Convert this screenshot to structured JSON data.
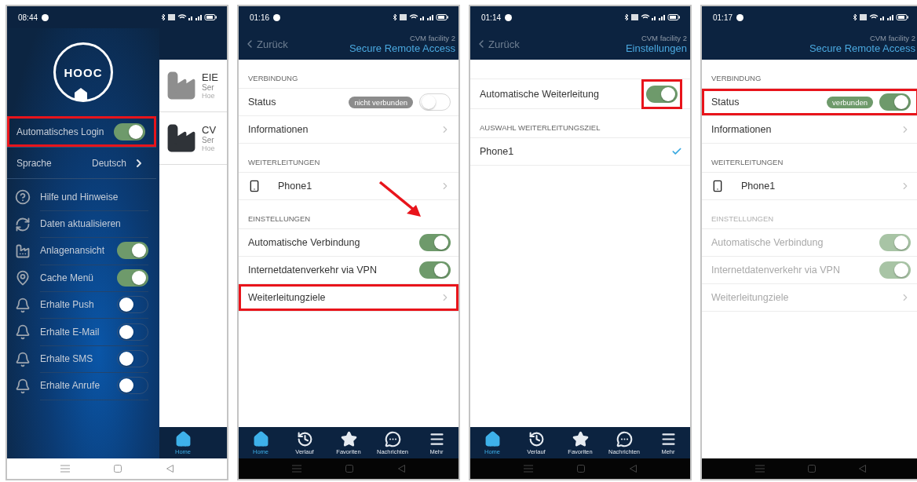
{
  "screens": [
    {
      "kind": "drawer",
      "time": "08:44",
      "logo": "HOOC",
      "light_system_bar": true,
      "account_rows": [
        {
          "kind": "toggle",
          "label": "Automatisches Login",
          "on": true,
          "highlighted": true
        },
        {
          "kind": "value",
          "label": "Sprache",
          "value": "Deutsch"
        }
      ],
      "menu": [
        {
          "kind": "link",
          "label": "Hilfe und Hinweise"
        },
        {
          "kind": "link",
          "label": "Daten aktualisieren"
        },
        {
          "kind": "toggle",
          "label": "Anlagenansicht",
          "on": true
        },
        {
          "kind": "toggle",
          "label": "Cache Menü",
          "on": true
        },
        {
          "kind": "toggle",
          "label": "Erhalte Push",
          "on": false
        },
        {
          "kind": "toggle",
          "label": "Erhalte E-Mail",
          "on": false
        },
        {
          "kind": "toggle",
          "label": "Erhalte SMS",
          "on": false
        },
        {
          "kind": "toggle",
          "label": "Erhalte Anrufe",
          "on": false
        }
      ],
      "list": [
        {
          "title": "EIE",
          "subtitle": "Ser",
          "detail": "Hoe",
          "color": "#8e8e8e"
        },
        {
          "title": "CV",
          "subtitle": "Ser",
          "detail": "Hoe",
          "color": "#2f3338"
        }
      ],
      "tabs": [
        {
          "label": "Home",
          "selected": true
        }
      ]
    },
    {
      "kind": "settings",
      "time": "01:16",
      "back": "Zurück",
      "subtitle": "CVM facility 2",
      "title": "Secure Remote Access",
      "light_system_bar": false,
      "sections": [
        {
          "header": "VERBINDUNG",
          "disabled": false,
          "rows": [
            {
              "kind": "status",
              "label": "Status",
              "badge": "nicht verbunden",
              "on": false
            },
            {
              "kind": "link",
              "label": "Informationen"
            }
          ]
        },
        {
          "header": "WEITERLEITUNGEN",
          "disabled": false,
          "rows": [
            {
              "kind": "device",
              "label": "Phone1"
            }
          ]
        },
        {
          "header": "EINSTELLUNGEN",
          "disabled": false,
          "rows": [
            {
              "kind": "toggle",
              "label": "Automatische Verbindung",
              "on": true,
              "arrow": true
            },
            {
              "kind": "toggle",
              "label": "Internetdatenverkehr via VPN",
              "on": true
            },
            {
              "kind": "link",
              "label": "Weiterleitungziele",
              "highlighted": true
            }
          ]
        }
      ],
      "tabs": [
        {
          "label": "Home",
          "selected": true
        },
        {
          "label": "Verlauf",
          "selected": false
        },
        {
          "label": "Favoriten",
          "selected": false
        },
        {
          "label": "Nachrichten",
          "selected": false
        },
        {
          "label": "Mehr",
          "selected": false
        }
      ]
    },
    {
      "kind": "settings",
      "time": "01:14",
      "back": "Zurück",
      "subtitle": "CVM facility 2",
      "title": "Einstellungen",
      "light_system_bar": false,
      "sections": [
        {
          "disabled": false,
          "rows": [
            {
              "kind": "toggle",
              "label": "Automatische Weiterleitung",
              "on": true,
              "toggle_highlighted": true
            }
          ]
        },
        {
          "header": "AUSWAHL WEITERLEITUNGSZIEL",
          "disabled": false,
          "rows": [
            {
              "kind": "check",
              "label": "Phone1",
              "checked": true
            }
          ]
        }
      ],
      "tabs": [
        {
          "label": "Home",
          "selected": true
        },
        {
          "label": "Verlauf",
          "selected": false
        },
        {
          "label": "Favoriten",
          "selected": false
        },
        {
          "label": "Nachrichten",
          "selected": false
        },
        {
          "label": "Mehr",
          "selected": false
        }
      ]
    },
    {
      "kind": "settings",
      "time": "01:17",
      "subtitle": "CVM facility 2",
      "title": "Secure Remote Access",
      "light_system_bar": false,
      "sections": [
        {
          "header": "VERBINDUNG",
          "disabled": false,
          "rows": [
            {
              "kind": "status",
              "label": "Status",
              "badge": "verbunden",
              "on": true,
              "highlighted": true
            },
            {
              "kind": "link",
              "label": "Informationen"
            }
          ]
        },
        {
          "header": "WEITERLEITUNGEN",
          "disabled": false,
          "rows": [
            {
              "kind": "device",
              "label": "Phone1"
            }
          ]
        },
        {
          "header": "EINSTELLUNGEN",
          "disabled": true,
          "rows": [
            {
              "kind": "toggle",
              "label": "Automatische Verbindung",
              "on": true
            },
            {
              "kind": "toggle",
              "label": "Internetdatenverkehr via VPN",
              "on": true
            },
            {
              "kind": "link",
              "label": "Weiterleitungziele"
            }
          ]
        }
      ]
    }
  ]
}
